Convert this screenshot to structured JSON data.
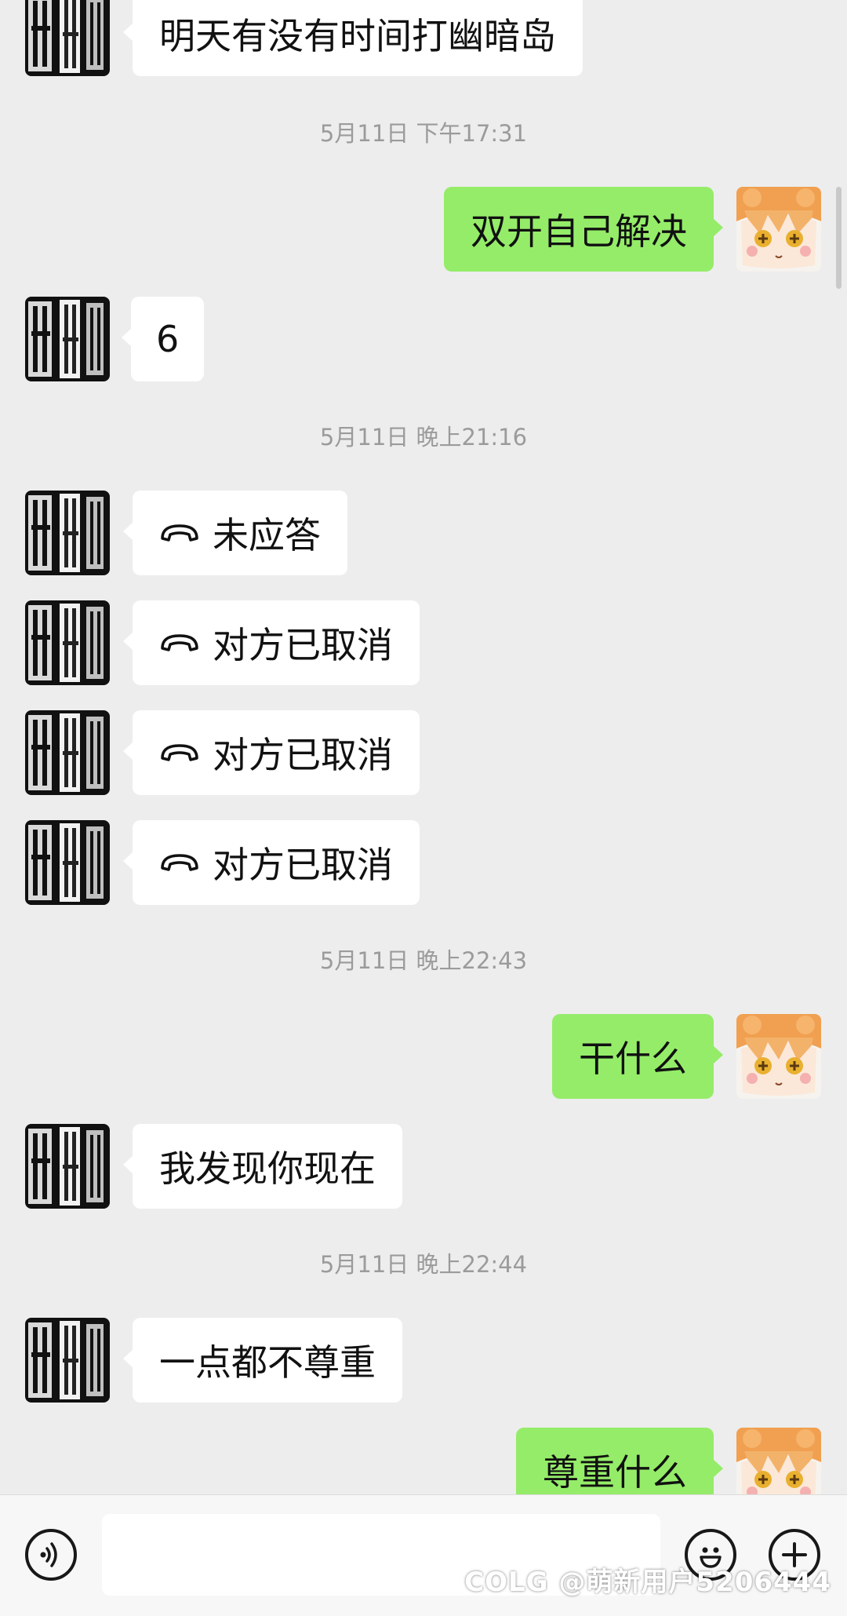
{
  "timestamps": [
    "5月11日 下午17:31",
    "5月11日 晚上21:16",
    "5月11日 晚上22:43",
    "5月11日 晚上22:44"
  ],
  "messages": [
    {
      "from": "other",
      "text": "明天有没有时间打幽暗岛"
    },
    {
      "from": "me",
      "text": "双开自己解决"
    },
    {
      "from": "other",
      "text": "6"
    },
    {
      "from": "other",
      "text": "未应答",
      "icon": "phone-hangup-icon"
    },
    {
      "from": "other",
      "text": "对方已取消",
      "icon": "phone-hangup-icon"
    },
    {
      "from": "other",
      "text": "对方已取消",
      "icon": "phone-hangup-icon"
    },
    {
      "from": "other",
      "text": "对方已取消",
      "icon": "phone-hangup-icon"
    },
    {
      "from": "me",
      "text": "干什么"
    },
    {
      "from": "other",
      "text": "我发现你现在"
    },
    {
      "from": "other",
      "text": "一点都不尊重"
    },
    {
      "from": "me",
      "text": "尊重什么"
    }
  ],
  "input_bar": {
    "voice_icon": "voice-icon",
    "input_value": "",
    "emoji_icon": "emoji-icon",
    "plus_icon": "plus-icon"
  },
  "watermark": "COLG @萌新用户5206444",
  "colors": {
    "background": "#ededed",
    "incoming_bubble": "#ffffff",
    "outgoing_bubble": "#95ec69",
    "timestamp": "#9b9b9b"
  }
}
